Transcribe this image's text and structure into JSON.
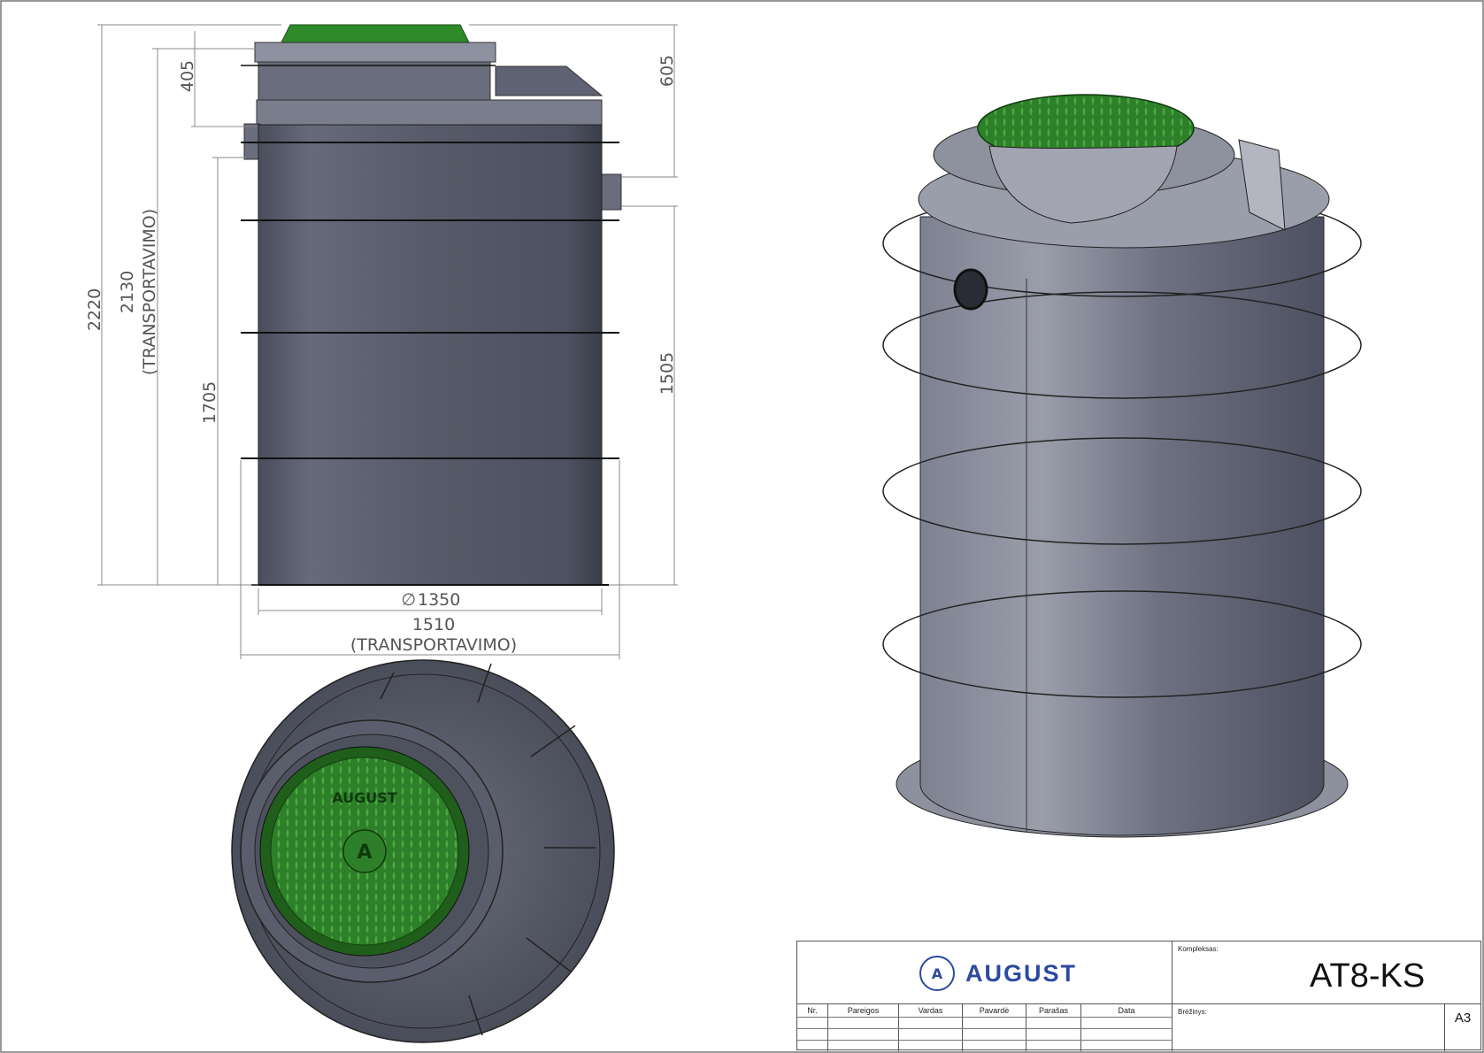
{
  "side_view": {
    "dimensions": {
      "overall_height": "2220",
      "transport_height_value": "2130",
      "transport_height_note": "(TRANSPORTAVIMO)",
      "cover_height": "405",
      "inlet_height": "1705",
      "top_to_outlet": "605",
      "outlet_height": "1505",
      "diameter_symbol": "∅",
      "diameter": "1350",
      "transport_width_value": "1510",
      "transport_width_note": "(TRANSPORTAVIMO)"
    }
  },
  "top_view": {
    "cover_brand": "AUGUST",
    "cover_logo_letter": "A"
  },
  "title_block": {
    "logo_letter": "A",
    "brand": "AUGUST",
    "complex_label": "Kompleksas:",
    "product_code": "AT8-KS",
    "drawing_label": "Brėžinys:",
    "sheet_size": "A3",
    "table_headers": [
      "Nr.",
      "Pareigos",
      "Vardas",
      "Pavardė",
      "Parašas",
      "Data"
    ]
  },
  "colors": {
    "tank_body": "#5c5f6e",
    "tank_dark": "#3c3f4b",
    "cover_green": "#2f8a2a",
    "brand_blue": "#2b4aa0",
    "dimension_line": "#888888"
  }
}
